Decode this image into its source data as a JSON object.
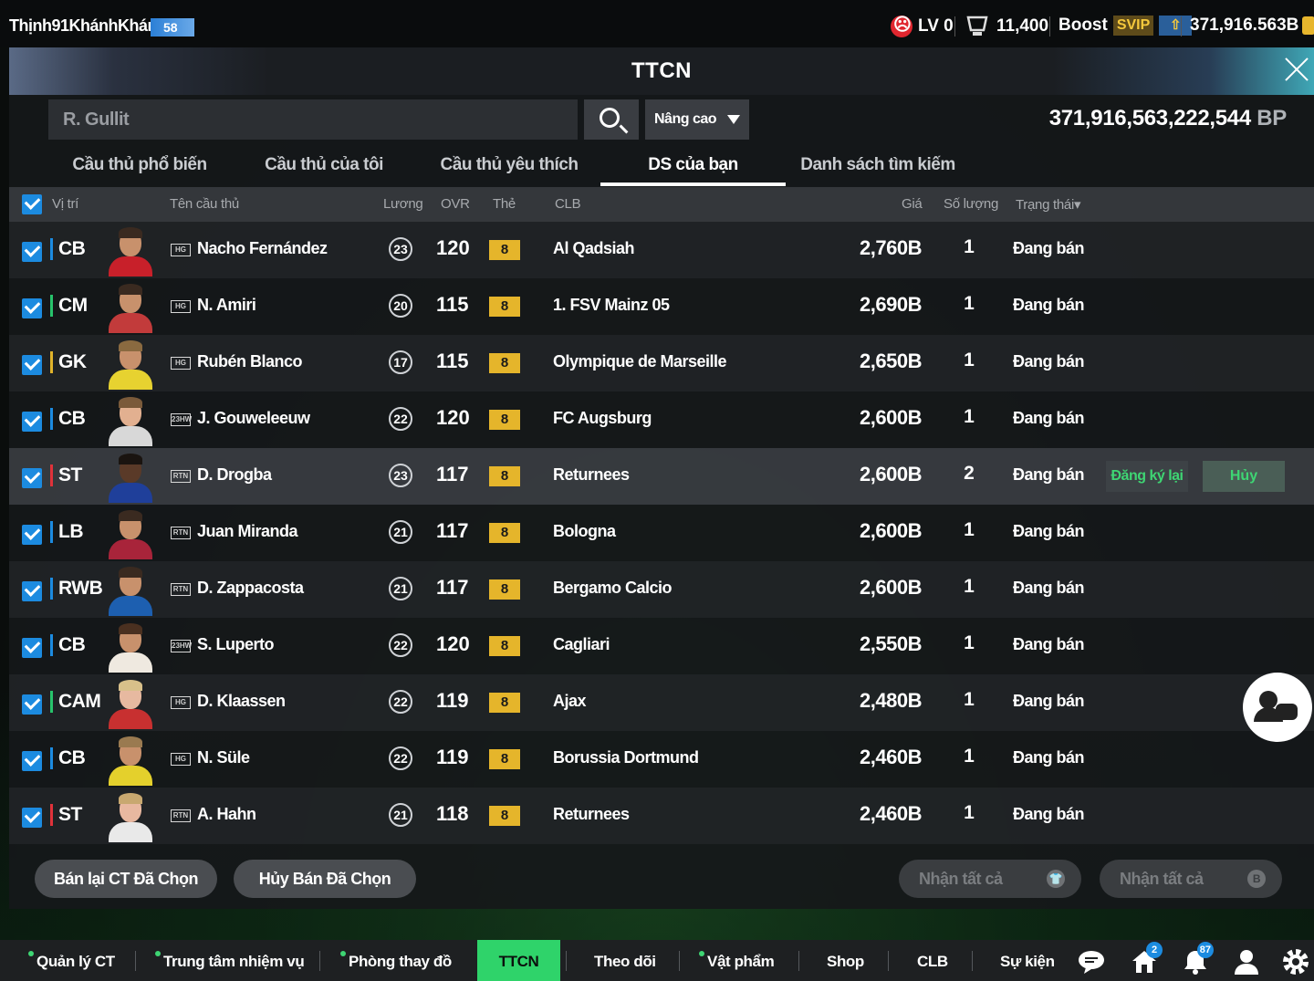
{
  "topbar": {
    "username": "Thịnh91KhánhKhán",
    "level": "58",
    "lv_label": "LV 0",
    "coins": "11,400",
    "boost_label": "Boost",
    "svip_label": "SVIP",
    "bp_short": "371,916.563B"
  },
  "panel": {
    "title": "TTCN",
    "search_value": "R. Gullit",
    "advanced_label": "Nâng cao",
    "bp_total": "371,916,563,222,544",
    "bp_unit": "BP"
  },
  "tabs": [
    {
      "label": "Cầu thủ phổ biến"
    },
    {
      "label": "Cầu thủ của tôi"
    },
    {
      "label": "Cầu thủ yêu thích"
    },
    {
      "label": "DS của bạn"
    },
    {
      "label": "Danh sách tìm kiếm"
    }
  ],
  "columns": {
    "position": "Vị trí",
    "player": "Tên cầu thủ",
    "wage": "Lương",
    "ovr": "OVR",
    "grade": "Thẻ",
    "club": "CLB",
    "price": "Giá",
    "qty": "Số lượng",
    "status": "Trạng thái▾"
  },
  "rows": [
    {
      "pos": "CB",
      "season": "HG",
      "name": "Nacho Fernández",
      "wage": "23",
      "ovr": "120",
      "grade": "8",
      "club": "Al Qadsiah",
      "price": "2,760B",
      "qty": "1",
      "status": "Đang bán"
    },
    {
      "pos": "CM",
      "season": "HG",
      "name": "N. Amiri",
      "wage": "20",
      "ovr": "115",
      "grade": "8",
      "club": "1. FSV Mainz 05",
      "price": "2,690B",
      "qty": "1",
      "status": "Đang bán"
    },
    {
      "pos": "GK",
      "season": "HG",
      "name": "Rubén Blanco",
      "wage": "17",
      "ovr": "115",
      "grade": "8",
      "club": "Olympique de Marseille",
      "price": "2,650B",
      "qty": "1",
      "status": "Đang bán"
    },
    {
      "pos": "CB",
      "season": "23HW",
      "name": "J. Gouweleeuw",
      "wage": "22",
      "ovr": "120",
      "grade": "8",
      "club": "FC Augsburg",
      "price": "2,600B",
      "qty": "1",
      "status": "Đang bán"
    },
    {
      "pos": "ST",
      "season": "RTN",
      "name": "D. Drogba",
      "wage": "23",
      "ovr": "117",
      "grade": "8",
      "club": "Returnees",
      "price": "2,600B",
      "qty": "2",
      "status": "Đang bán",
      "relist": "Đăng ký lại",
      "cancel": "Hủy"
    },
    {
      "pos": "LB",
      "season": "RTN",
      "name": "Juan Miranda",
      "wage": "21",
      "ovr": "117",
      "grade": "8",
      "club": "Bologna",
      "price": "2,600B",
      "qty": "1",
      "status": "Đang bán"
    },
    {
      "pos": "RWB",
      "season": "RTN",
      "name": "D. Zappacosta",
      "wage": "21",
      "ovr": "117",
      "grade": "8",
      "club": "Bergamo Calcio",
      "price": "2,600B",
      "qty": "1",
      "status": "Đang bán"
    },
    {
      "pos": "CB",
      "season": "23HW",
      "name": "S. Luperto",
      "wage": "22",
      "ovr": "120",
      "grade": "8",
      "club": "Cagliari",
      "price": "2,550B",
      "qty": "1",
      "status": "Đang bán"
    },
    {
      "pos": "CAM",
      "season": "HG",
      "name": "D. Klaassen",
      "wage": "22",
      "ovr": "119",
      "grade": "8",
      "club": "Ajax",
      "price": "2,480B",
      "qty": "1",
      "status": "Đang bán"
    },
    {
      "pos": "CB",
      "season": "HG",
      "name": "N. Süle",
      "wage": "22",
      "ovr": "119",
      "grade": "8",
      "club": "Borussia Dortmund",
      "price": "2,460B",
      "qty": "1",
      "status": "Đang bán"
    },
    {
      "pos": "ST",
      "season": "RTN",
      "name": "A. Hahn",
      "wage": "21",
      "ovr": "118",
      "grade": "8",
      "club": "Returnees",
      "price": "2,460B",
      "qty": "1",
      "status": "Đang bán"
    }
  ],
  "actions": {
    "resell_selected": "Bán lại CT Đã Chọn",
    "cancel_selected": "Hủy Bán Đã Chọn",
    "claim_all_1": "Nhận tất cả",
    "claim_all_2": "Nhận tất cả"
  },
  "navbar": {
    "items": [
      "Quản lý CT",
      "Trung tâm nhiệm vụ",
      "Phòng thay đồ",
      "TTCN",
      "Theo dõi",
      "Vật phẩm",
      "Shop",
      "CLB",
      "Sự kiện"
    ],
    "home_badge": "2",
    "notif_badge": "87"
  },
  "colors": {
    "accent_green": "#2fd36a",
    "checkbox_blue": "#1c8be0",
    "grade_gold": "#e5b52b"
  }
}
